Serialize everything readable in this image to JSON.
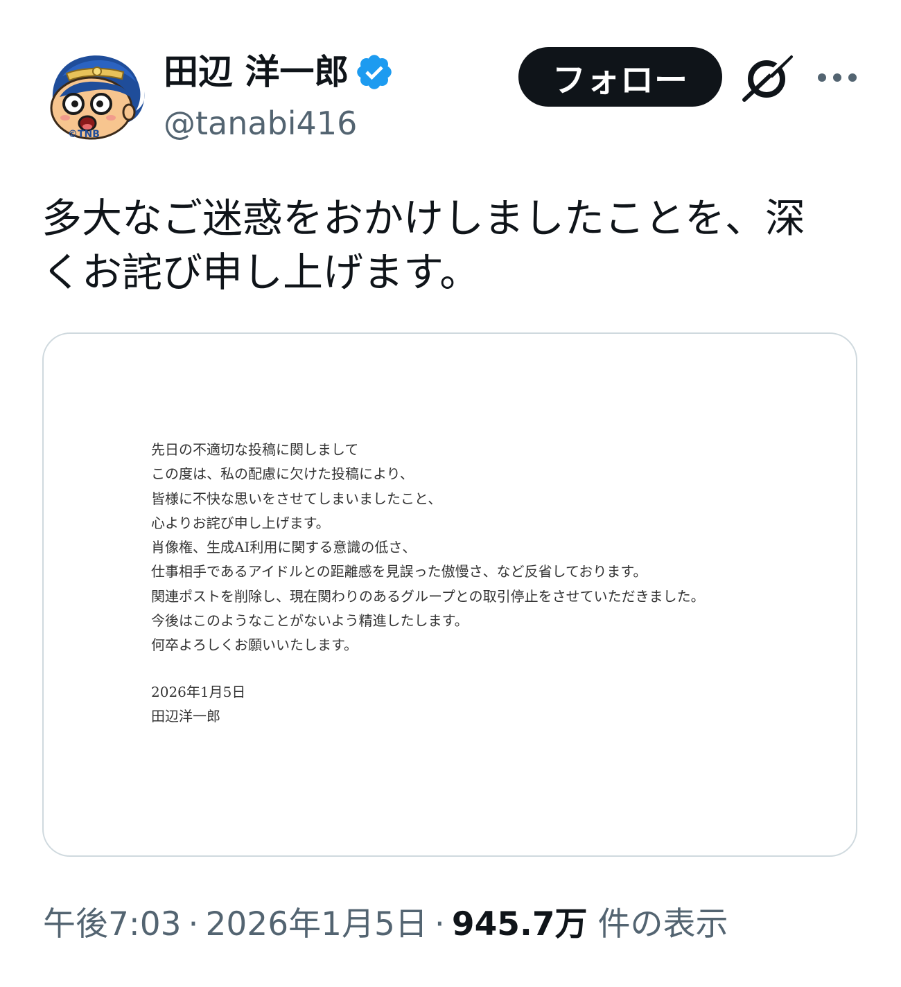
{
  "author": {
    "display_name": "田辺 洋一郎",
    "handle": "@tanabi416",
    "avatar_caption": "©TNB",
    "verified": true,
    "verified_color": "#1d9bf0"
  },
  "actions": {
    "follow_label": "フォロー"
  },
  "post": {
    "text_lines": [
      "多大なご迷惑をおかけしましたことを、深",
      "くお詫び申し上げます。"
    ]
  },
  "media": {
    "letter_lines": [
      "先日の不適切な投稿に関しまして",
      "この度は、私の配慮に欠けた投稿により、",
      "皆様に不快な思いをさせてしまいましたこと、",
      "心よりお詫び申し上げます。",
      "肖像権、生成AI利用に関する意識の低さ、",
      "仕事相手であるアイドルとの距離感を見誤った傲慢さ、など反省しております。",
      "関連ポストを削除し、現在関わりのあるグループとの取引停止をさせていただきました。",
      "今後はこのようなことがないよう精進したします。",
      "何卒よろしくお願いいたします。"
    ],
    "date": "2026年1月5日",
    "signature": "田辺洋一郎"
  },
  "meta": {
    "time": "午後7:03",
    "separator": "·",
    "date": "2026年1月5日",
    "views_count": "945.7万",
    "views_label": "件の表示"
  },
  "colors": {
    "text_primary": "#0f1419",
    "text_secondary": "#536471",
    "border": "#cfd9de",
    "follow_bg": "#0f1419"
  }
}
